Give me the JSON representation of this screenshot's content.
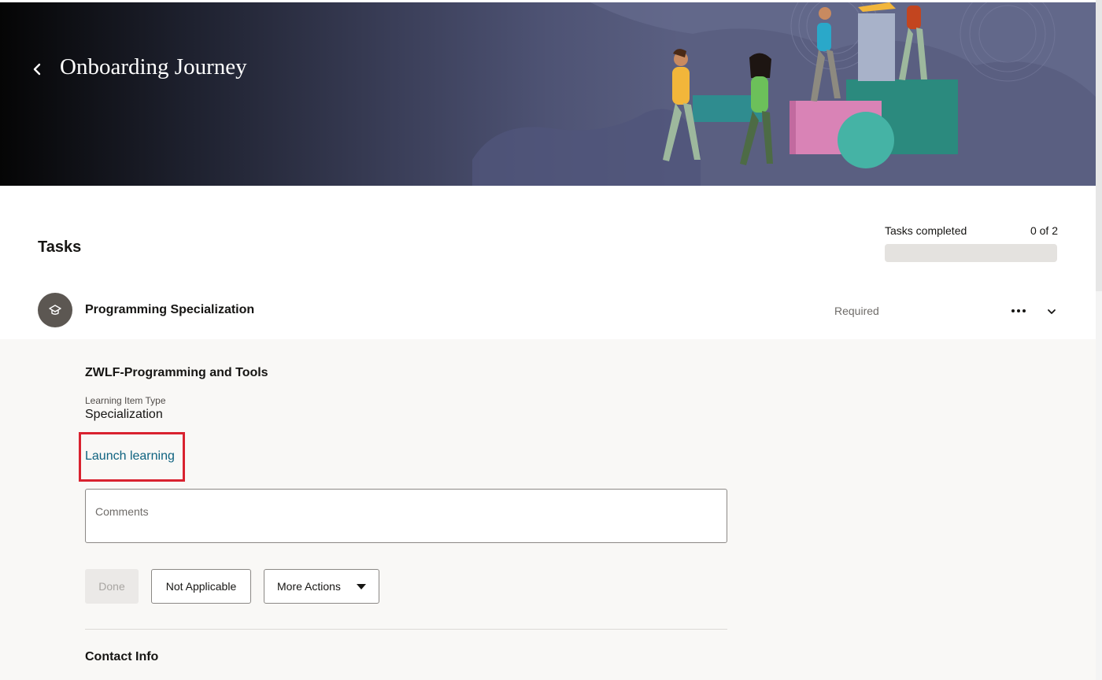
{
  "header": {
    "title": "Onboarding Journey",
    "back_icon": "chevron-left-icon"
  },
  "tasks": {
    "title": "Tasks",
    "progress_label": "Tasks completed",
    "progress_count": "0 of 2",
    "progress_fraction": 0
  },
  "task": {
    "icon": "graduation-cap-icon",
    "title": "Programming Specialization",
    "status": "Required",
    "more_icon": "ellipsis-icon",
    "expand_icon": "chevron-down-icon"
  },
  "detail": {
    "item_name": "ZWLF-Programming and Tools",
    "type_label": "Learning Item Type",
    "type_value": "Specialization",
    "launch_link": "Launch learning",
    "comments_placeholder": "Comments",
    "buttons": {
      "done": "Done",
      "not_applicable": "Not Applicable",
      "more_actions": "More Actions"
    },
    "contact_title": "Contact Info"
  },
  "colors": {
    "link": "#0f6380",
    "highlight": "#d9222f",
    "banner_end": "#5a5f81"
  }
}
